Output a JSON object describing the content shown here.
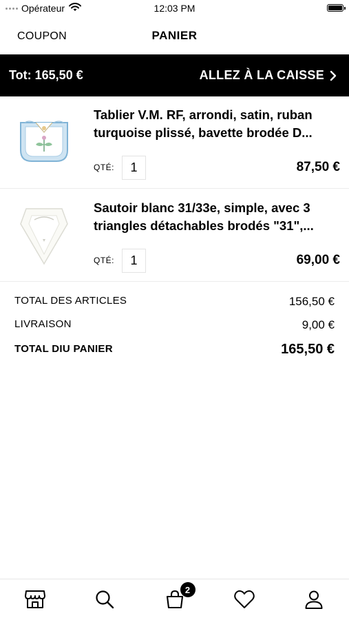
{
  "status_bar": {
    "carrier": "Opérateur",
    "time": "12:03 PM"
  },
  "nav": {
    "coupon_label": "COUPON",
    "title": "PANIER"
  },
  "checkout_bar": {
    "total": "Tot: 165,50 €",
    "action_label": "ALLEZ À LA CAISSE"
  },
  "cart": {
    "qty_label": "QTÉ:",
    "items": [
      {
        "title": "Tablier V.M. RF, arrondi, satin, ruban turquoise plissé, bavette brodée D...",
        "quantity": "1",
        "price": "87,50 €"
      },
      {
        "title": "Sautoir blanc 31/33e, simple, avec 3 triangles détachables brodés \"31\",...",
        "quantity": "1",
        "price": "69,00 €"
      }
    ]
  },
  "summary": {
    "items_total_label": "TOTAL DES ARTICLES",
    "items_total_value": "156,50 €",
    "shipping_label": "LIVRAISON",
    "shipping_value": "9,00 €",
    "cart_total_label": "TOTAL DIU PANIER",
    "cart_total_value": "165,50 €"
  },
  "tab_bar": {
    "tabs": [
      "store-icon",
      "search-icon",
      "cart-icon",
      "heart-icon",
      "user-icon"
    ],
    "cart_badge": "2"
  }
}
